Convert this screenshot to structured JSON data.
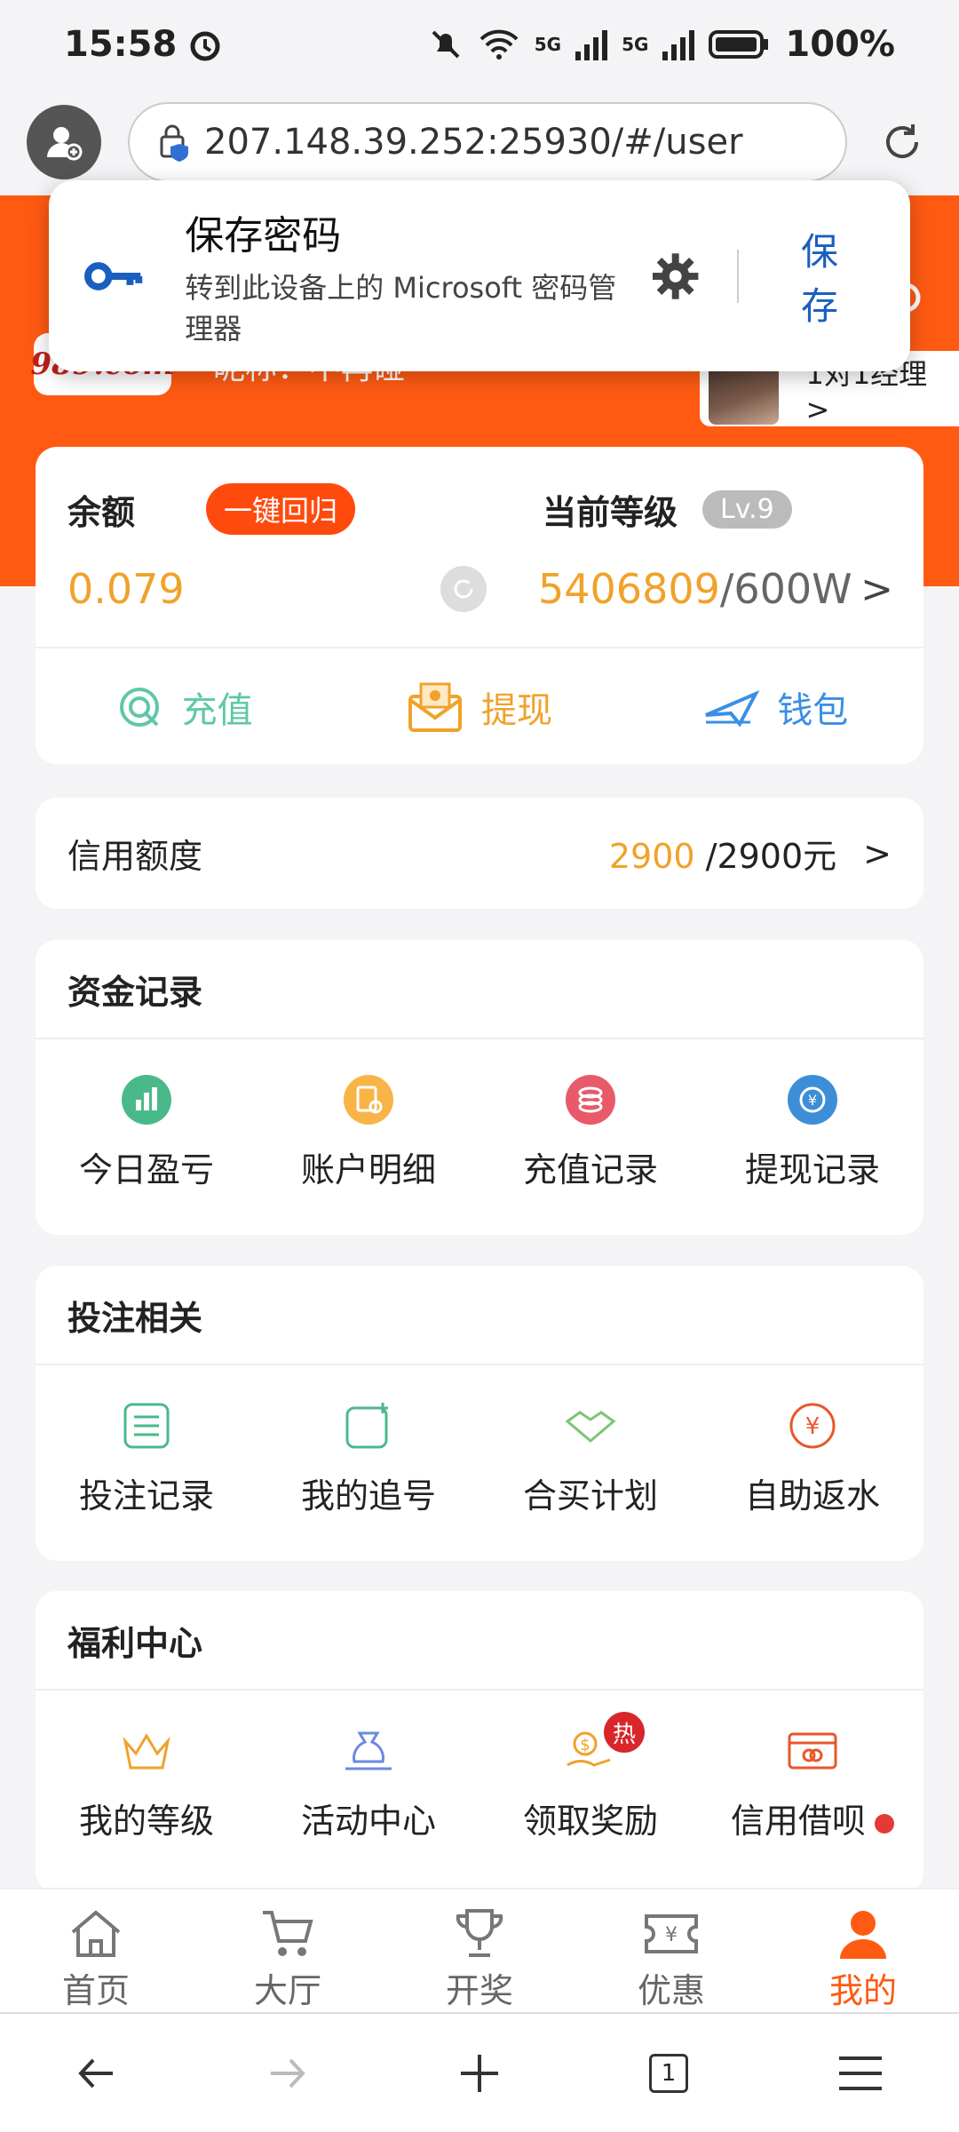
{
  "status": {
    "time": "15:58",
    "network": "5G",
    "battery": "100%"
  },
  "browser": {
    "url": "207.148.39.252:25930/#/user"
  },
  "popup": {
    "title": "保存密码",
    "subtitle": "转到此设备上的 Microsoft 密码管理器",
    "save": "保存"
  },
  "profile": {
    "logo": "989.com",
    "nickname": "昵称：不再碰",
    "manager": "1对1经理 >"
  },
  "balance": {
    "label": "余额",
    "return_btn": "一键回归",
    "value": "0.079",
    "level_label": "当前等级",
    "level": "Lv.9",
    "exp_current": "5406809",
    "exp_total": "/600W",
    "arrow": ">"
  },
  "actions": [
    {
      "label": "充值",
      "icon": "recharge-icon",
      "color": "#5ec7a8"
    },
    {
      "label": "提现",
      "icon": "withdraw-envelope-icon",
      "color": "#f0a22a"
    },
    {
      "label": "钱包",
      "icon": "wallet-plane-icon",
      "color": "#3a8ee6"
    }
  ],
  "credit": {
    "label": "信用额度",
    "current": "2900",
    "total": " /2900元",
    "arrow": ">"
  },
  "funds": {
    "title": "资金记录",
    "items": [
      "今日盈亏",
      "账户明细",
      "充值记录",
      "提现记录"
    ]
  },
  "betting": {
    "title": "投注相关",
    "items": [
      "投注记录",
      "我的追号",
      "合买计划",
      "自助返水"
    ]
  },
  "welfare": {
    "title": "福利中心",
    "items": [
      "我的等级",
      "活动中心",
      "领取奖励",
      "信用借呗"
    ],
    "hot_badge": "热"
  },
  "tabs": [
    {
      "label": "首页",
      "icon": "home-icon"
    },
    {
      "label": "大厅",
      "icon": "cart-icon"
    },
    {
      "label": "开奖",
      "icon": "trophy-icon"
    },
    {
      "label": "优惠",
      "icon": "coupon-icon"
    },
    {
      "label": "我的",
      "icon": "person-icon",
      "active": true
    }
  ],
  "browser_nav": {
    "tab_count": "1"
  },
  "colors": {
    "orange": "#ff5a12",
    "gold": "#f0a22a",
    "blue": "#1a5fc0"
  }
}
